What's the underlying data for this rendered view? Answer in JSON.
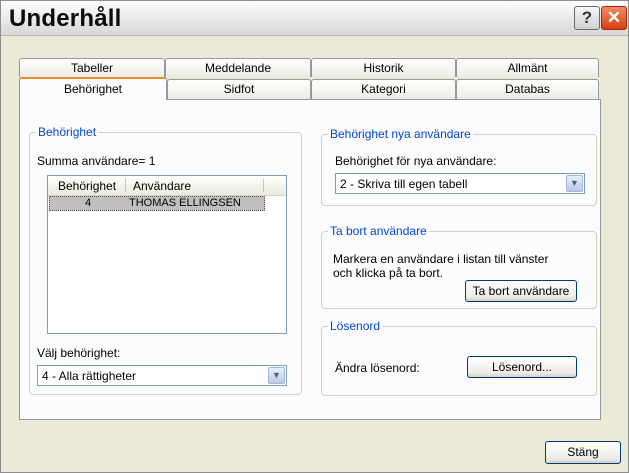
{
  "window": {
    "title": "Underhåll"
  },
  "titlebar": {
    "help_label": "?",
    "close_label": "✕"
  },
  "tabs": {
    "row1": [
      "Tabeller",
      "Meddelande",
      "Historik",
      "Allmänt"
    ],
    "row2": [
      "Behörighet",
      "Sidfot",
      "Kategori",
      "Databas"
    ],
    "active": "Behörighet"
  },
  "permissions_group": {
    "legend": "Behörighet",
    "user_count_label": "Summa användare= 1",
    "list": {
      "columns": [
        "Behörighet",
        "Användare"
      ],
      "rows": [
        {
          "permission": "4",
          "user": "THOMAS ELLINGSEN"
        }
      ]
    },
    "select_label": "Välj behörighet:",
    "select_value": "4 - Alla rättigheter"
  },
  "new_users_group": {
    "legend": "Behörighet nya användare",
    "label": "Behörighet för nya användare:",
    "select_value": "2 - Skriva till egen tabell"
  },
  "remove_user_group": {
    "legend": "Ta bort användare",
    "description_line1": "Markera en användare i listan till vänster",
    "description_line2": "och klicka på ta bort.",
    "button_label": "Ta bort användare"
  },
  "password_group": {
    "legend": "Lösenord",
    "label": "Ändra lösenord:",
    "button_label": "Lösenord..."
  },
  "footer": {
    "close_button_label": "Stäng"
  }
}
